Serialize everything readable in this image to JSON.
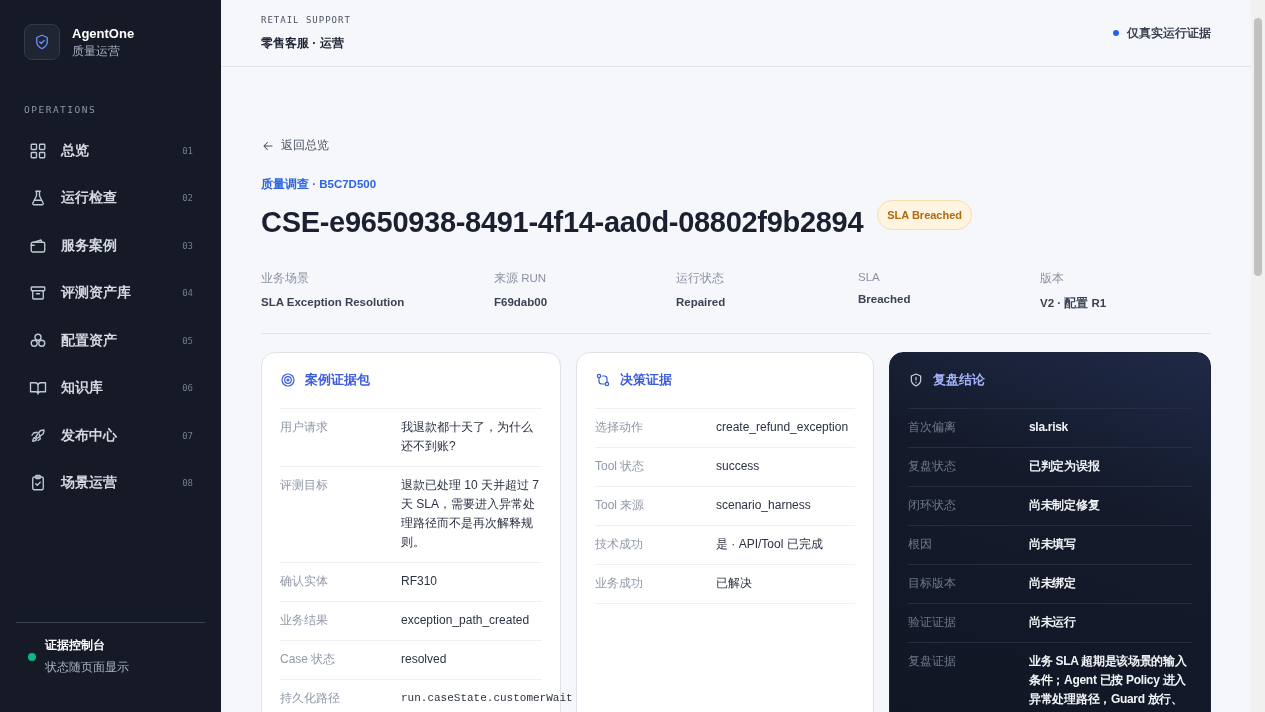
{
  "brand": {
    "name": "AgentOne",
    "subtitle": "质量运营"
  },
  "sidebar": {
    "section": "OPERATIONS",
    "items": [
      {
        "label": "总览",
        "number": "01",
        "selected": false
      },
      {
        "label": "运行检查",
        "number": "02",
        "selected": false
      },
      {
        "label": "服务案例",
        "number": "03",
        "selected": false
      },
      {
        "label": "评测资产库",
        "number": "04",
        "selected": false
      },
      {
        "label": "配置资产",
        "number": "05",
        "selected": false
      },
      {
        "label": "知识库",
        "number": "06",
        "selected": false
      },
      {
        "label": "发布中心",
        "number": "07",
        "selected": false
      },
      {
        "label": "场景运营",
        "number": "08",
        "selected": false
      }
    ],
    "footer": {
      "title": "证据控制台",
      "subtitle": "状态随页面显示",
      "color": "#10b981"
    }
  },
  "header": {
    "eyebrow": "RETAIL SUPPORT",
    "title": "零售客服 · 运营",
    "status": {
      "label": "仅真实运行证据",
      "color": "#2563eb"
    }
  },
  "case": {
    "back": "返回总览",
    "breadcrumb": "质量调查 · B5C7D500",
    "title": "CSE-e9650938-8491-4f14-aa0d-08802f9b2894",
    "badge": "SLA Breached",
    "meta": [
      {
        "label": "业务场景",
        "value": "SLA Exception Resolution"
      },
      {
        "label": "来源 RUN",
        "value": "F69dab00"
      },
      {
        "label": "运行状态",
        "value": "Repaired"
      },
      {
        "label": "SLA",
        "value": "Breached"
      },
      {
        "label": "版本",
        "value": "V2 · 配置 R1"
      }
    ],
    "cards": [
      {
        "title": "案例证据包",
        "kind": "light",
        "rows": [
          {
            "label": "用户请求",
            "value": "我退款都十天了，为什么还不到账?",
            "kind": "text"
          },
          {
            "label": "评测目标",
            "value": "退款已处理 10 天并超过 7 天 SLA，需要进入异常处理路径而不是再次解释规则。",
            "kind": "text"
          },
          {
            "label": "确认实体",
            "value": "RF310",
            "kind": "text"
          },
          {
            "label": "业务结果",
            "value": "exception_path_created",
            "kind": "text"
          },
          {
            "label": "Case 状态",
            "value": "resolved",
            "kind": "text"
          },
          {
            "label": "持久化路径",
            "value": "run.caseState.customerWait",
            "kind": "code"
          }
        ]
      },
      {
        "title": "决策证据",
        "kind": "light",
        "rows": [
          {
            "label": "选择动作",
            "value": "create_refund_exception",
            "kind": "text"
          },
          {
            "label": "Tool 状态",
            "value": "success",
            "kind": "text"
          },
          {
            "label": "Tool 来源",
            "value": "scenario_harness",
            "kind": "text"
          },
          {
            "label": "技术成功",
            "value": "是 · API/Tool 已完成",
            "kind": "text"
          },
          {
            "label": "业务成功",
            "value": "已解决",
            "kind": "text"
          }
        ]
      },
      {
        "title": "复盘结论",
        "kind": "dark",
        "rows": [
          {
            "label": "首次偏离",
            "value": "sla.risk",
            "kind": "text"
          },
          {
            "label": "复盘状态",
            "value": "已判定为误报",
            "kind": "text"
          },
          {
            "label": "闭环状态",
            "value": "尚未制定修复",
            "kind": "text"
          },
          {
            "label": "根因",
            "value": "尚未填写",
            "kind": "text"
          },
          {
            "label": "目标版本",
            "value": "尚未绑定",
            "kind": "text"
          },
          {
            "label": "验证证据",
            "value": "尚未运行",
            "kind": "text"
          },
          {
            "label": "复盘证据",
            "value": "业务 SLA 超期是该场景的输入条件；Agent 已按 Policy 进入异常处理路径，Guard 放行、",
            "kind": "text"
          }
        ]
      }
    ]
  }
}
